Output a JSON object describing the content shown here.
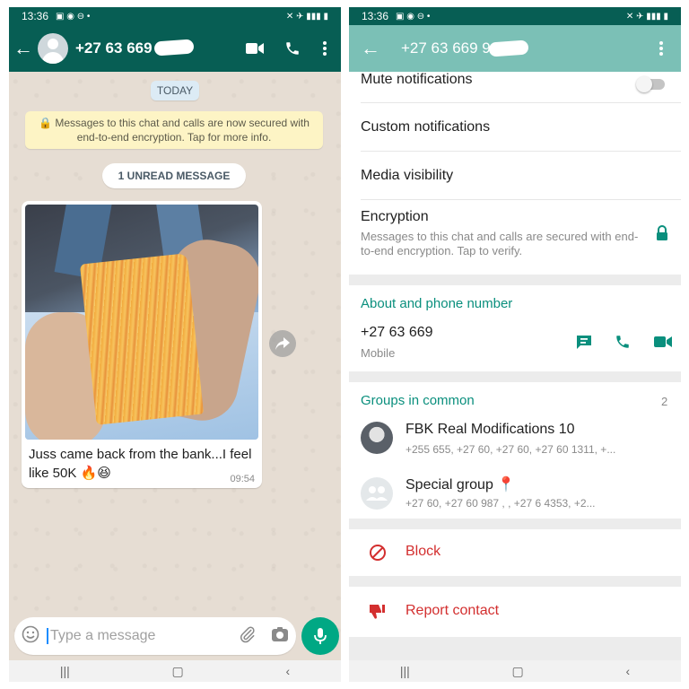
{
  "left": {
    "status": {
      "time": "13:36"
    },
    "header": {
      "contact": "+27 63 669"
    },
    "chat": {
      "date_chip": "TODAY",
      "encryption_notice": "🔒 Messages to this chat and calls are now secured with end-to-end encryption. Tap for more info.",
      "unread_label": "1 UNREAD MESSAGE",
      "message": {
        "text": "Juss came back from the bank...I feel like 50K 🔥😆",
        "time": "09:54"
      }
    },
    "input": {
      "placeholder": "Type a message"
    }
  },
  "right": {
    "status": {
      "time": "13:36"
    },
    "header": {
      "contact": "+27 63 669 9"
    },
    "items": {
      "mute": "Mute notifications",
      "custom": "Custom notifications",
      "media": "Media visibility",
      "encryption_title": "Encryption",
      "encryption_desc": "Messages to this chat and calls are secured with end-to-end encryption. Tap to verify."
    },
    "about": {
      "section": "About and phone number",
      "phone": "+27 63 669 ",
      "phone_label": "Mobile"
    },
    "groups": {
      "section": "Groups in common",
      "count": "2",
      "list": [
        {
          "name": "FBK Real Modifications 10",
          "members": "+255 655, +27 60, +27 60, +27 60    1311, +..."
        },
        {
          "name": "Special group 📍",
          "members": "+27 60, +27 60 987 ,    , +27 6     4353, +2..."
        }
      ]
    },
    "actions": {
      "block": "Block",
      "report": "Report contact"
    }
  },
  "colors": {
    "header_dark": "#075e54",
    "header_light": "#7bc0b6",
    "accent": "#0a8f7d",
    "danger": "#d32f2f"
  }
}
